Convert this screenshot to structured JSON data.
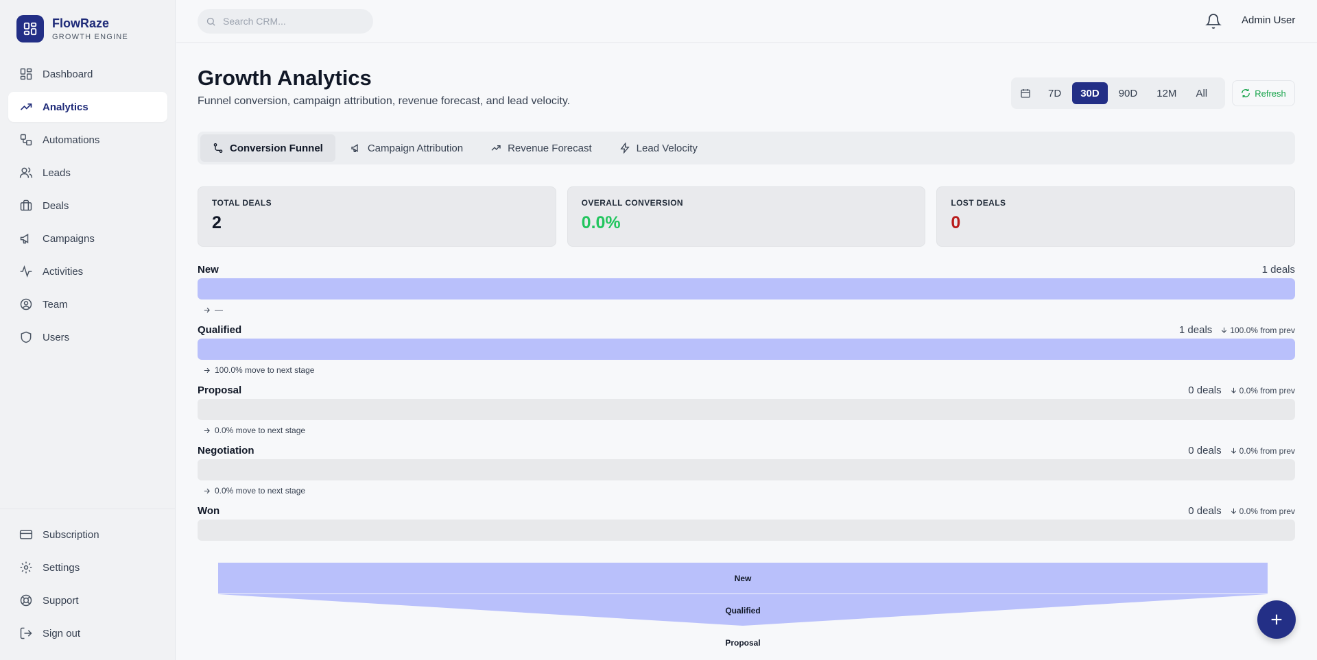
{
  "brand": {
    "name": "FlowRaze",
    "subtitle": "GROWTH ENGINE"
  },
  "sidebar": {
    "items": [
      {
        "label": "Dashboard",
        "icon": "dashboard-icon"
      },
      {
        "label": "Analytics",
        "icon": "trending-up-icon",
        "active": true
      },
      {
        "label": "Automations",
        "icon": "workflow-icon"
      },
      {
        "label": "Leads",
        "icon": "users-icon"
      },
      {
        "label": "Deals",
        "icon": "briefcase-icon"
      },
      {
        "label": "Campaigns",
        "icon": "megaphone-icon"
      },
      {
        "label": "Activities",
        "icon": "activity-icon"
      },
      {
        "label": "Team",
        "icon": "user-circle-icon"
      },
      {
        "label": "Users",
        "icon": "shield-icon"
      }
    ],
    "bottom": [
      {
        "label": "Subscription",
        "icon": "credit-card-icon"
      },
      {
        "label": "Settings",
        "icon": "gear-icon"
      },
      {
        "label": "Support",
        "icon": "lifebuoy-icon"
      },
      {
        "label": "Sign out",
        "icon": "sign-out-icon"
      }
    ]
  },
  "topbar": {
    "search_placeholder": "Search CRM...",
    "user_name": "Admin User"
  },
  "page": {
    "title": "Growth Analytics",
    "subtitle": "Funnel conversion, campaign attribution, revenue forecast, and lead velocity."
  },
  "range": {
    "options": [
      "7D",
      "30D",
      "90D",
      "12M",
      "All"
    ],
    "selected": "30D",
    "refresh_label": "Refresh"
  },
  "tabs": [
    {
      "label": "Conversion Funnel",
      "icon": "funnel-icon",
      "active": true
    },
    {
      "label": "Campaign Attribution",
      "icon": "megaphone-icon"
    },
    {
      "label": "Revenue Forecast",
      "icon": "trending-up-icon"
    },
    {
      "label": "Lead Velocity",
      "icon": "zap-icon"
    }
  ],
  "stats": [
    {
      "label": "TOTAL DEALS",
      "value": "2",
      "tone": "default"
    },
    {
      "label": "OVERALL CONVERSION",
      "value": "0.0%",
      "tone": "green"
    },
    {
      "label": "LOST DEALS",
      "value": "0",
      "tone": "red"
    }
  ],
  "stages": [
    {
      "name": "New",
      "count": "1 deals",
      "prev": "",
      "next": "—",
      "fill": 1.0
    },
    {
      "name": "Qualified",
      "count": "1 deals",
      "prev": "100.0% from prev",
      "next": "100.0% move to next stage",
      "fill": 1.0
    },
    {
      "name": "Proposal",
      "count": "0 deals",
      "prev": "0.0% from prev",
      "next": "0.0% move to next stage",
      "fill": 0.0
    },
    {
      "name": "Negotiation",
      "count": "0 deals",
      "prev": "0.0% from prev",
      "next": "0.0% move to next stage",
      "fill": 0.0
    },
    {
      "name": "Won",
      "count": "0 deals",
      "prev": "0.0% from prev",
      "next": "",
      "fill": 0.0
    }
  ],
  "funnel_labels": [
    "New",
    "Qualified",
    "Proposal"
  ],
  "colors": {
    "brand": "#232f86",
    "bar_fill": "#b9c0fb",
    "green": "#22c55e",
    "red": "#b91c1c"
  }
}
